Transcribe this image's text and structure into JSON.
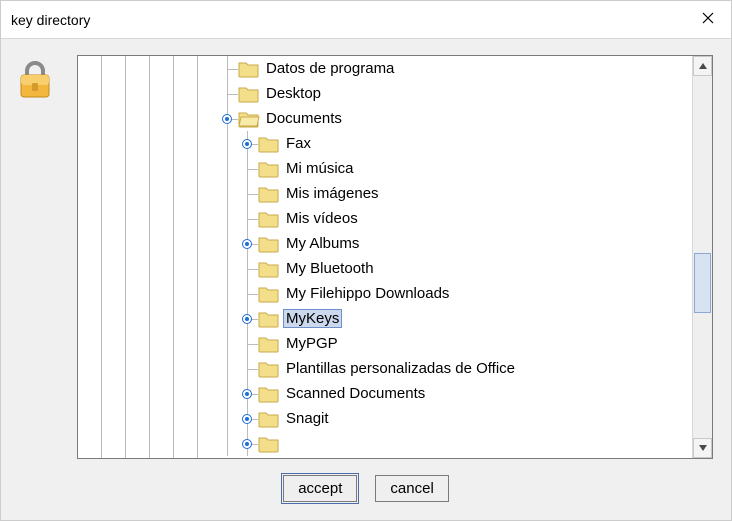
{
  "window": {
    "title": "key directory"
  },
  "tree_root": {
    "top": [
      {
        "label": "Datos de programa",
        "expandable": false
      },
      {
        "label": "Desktop",
        "expandable": false
      }
    ],
    "documents": {
      "label": "Documents",
      "children": [
        {
          "label": "Fax",
          "expandable": true
        },
        {
          "label": "Mi música",
          "expandable": false
        },
        {
          "label": "Mis imágenes",
          "expandable": false
        },
        {
          "label": "Mis vídeos",
          "expandable": false
        },
        {
          "label": "My Albums",
          "expandable": true
        },
        {
          "label": "My Bluetooth",
          "expandable": false
        },
        {
          "label": "My Filehippo Downloads",
          "expandable": false
        },
        {
          "label": "MyKeys",
          "expandable": true,
          "selected": true
        },
        {
          "label": "MyPGP",
          "expandable": false
        },
        {
          "label": "Plantillas personalizadas de Office",
          "expandable": false
        },
        {
          "label": "Scanned Documents",
          "expandable": true
        },
        {
          "label": "Snagit",
          "expandable": true
        }
      ]
    }
  },
  "buttons": {
    "accept": "accept",
    "cancel": "cancel"
  }
}
